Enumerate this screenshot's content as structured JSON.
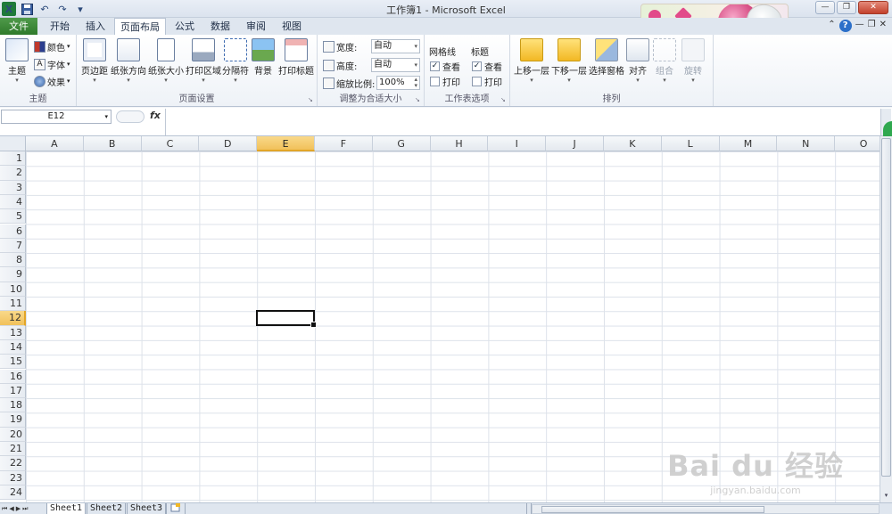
{
  "window": {
    "title": "工作簿1 - Microsoft Excel",
    "minimize": "—",
    "restore": "❐",
    "close": "✕"
  },
  "qat": {
    "logo": "X",
    "save_icon": "save-icon",
    "undo": "↶",
    "redo": "↷",
    "customize": "▾"
  },
  "tabs": {
    "file": "文件",
    "home": "开始",
    "insert": "插入",
    "page_layout": "页面布局",
    "formulas": "公式",
    "data": "数据",
    "review": "审阅",
    "view": "视图",
    "help": "?"
  },
  "ribbon": {
    "themes": {
      "label": "主题",
      "theme_btn": "主题",
      "colors": "颜色",
      "fonts": "字体",
      "effects": "效果"
    },
    "page_setup": {
      "label": "页面设置",
      "margins": "页边距",
      "orientation": "纸张方向",
      "size": "纸张大小",
      "print_area": "打印区域",
      "breaks": "分隔符",
      "background": "背景",
      "print_titles": "打印标题"
    },
    "scale": {
      "label": "调整为合适大小",
      "width_label": "宽度:",
      "width_value": "自动",
      "height_label": "高度:",
      "height_value": "自动",
      "scale_label": "缩放比例:",
      "scale_value": "100%"
    },
    "sheet_options": {
      "label": "工作表选项",
      "gridlines": "网格线",
      "headings": "标题",
      "view": "查看",
      "print": "打印"
    },
    "arrange": {
      "label": "排列",
      "bring_forward": "上移一层",
      "send_backward": "下移一层",
      "selection_pane": "选择窗格",
      "align": "对齐",
      "group": "组合",
      "rotate": "旋转"
    }
  },
  "formula_bar": {
    "name_box": "E12",
    "fx": "fx",
    "value": ""
  },
  "grid": {
    "columns": [
      "A",
      "B",
      "C",
      "D",
      "E",
      "F",
      "G",
      "H",
      "I",
      "J",
      "K",
      "L",
      "M",
      "N",
      "O"
    ],
    "rows": [
      "1",
      "2",
      "3",
      "4",
      "5",
      "6",
      "7",
      "8",
      "9",
      "10",
      "11",
      "12",
      "13",
      "14",
      "15",
      "16",
      "17",
      "18",
      "19",
      "20",
      "21",
      "22",
      "23",
      "24"
    ],
    "selected_column": "E",
    "selected_row": "12"
  },
  "sheets": {
    "tabs": [
      "Sheet1",
      "Sheet2",
      "Sheet3"
    ],
    "active": "Sheet1",
    "nav": [
      "⏮",
      "◀",
      "▶",
      "⏭"
    ]
  },
  "watermark": {
    "brand": "Bai du 经验",
    "url": "jingyan.baidu.com"
  },
  "colors": {
    "file_tab": "#2f7a2b",
    "selection_header": "#f1c15a"
  }
}
